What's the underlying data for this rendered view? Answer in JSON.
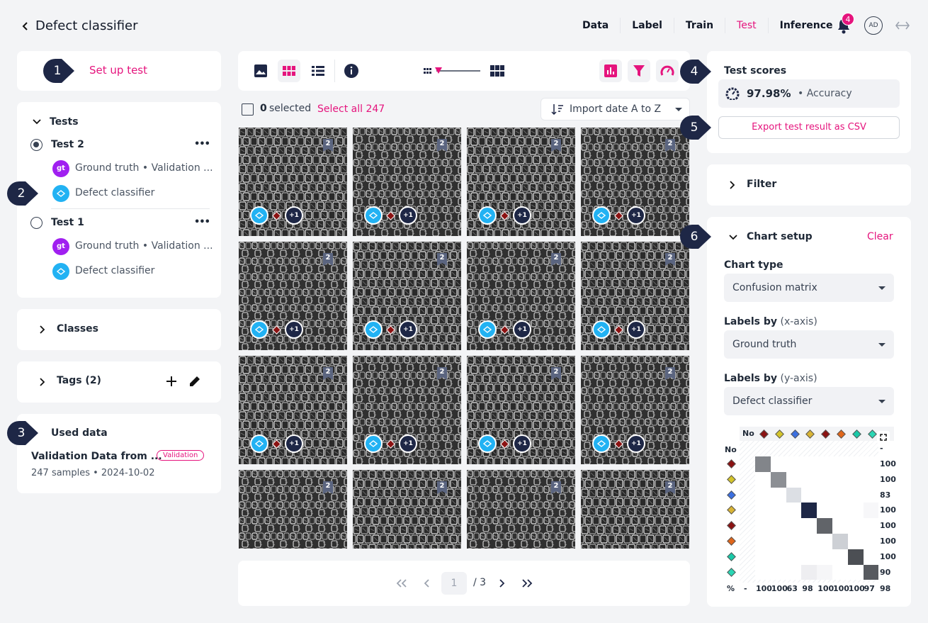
{
  "header": {
    "back_title": "Defect classifier",
    "nav": [
      "Data",
      "Label",
      "Train",
      "Test",
      "Inference"
    ],
    "active_nav": "Test",
    "notif_count": "4",
    "avatar": "AD"
  },
  "markers": [
    "1",
    "2",
    "3",
    "4",
    "5",
    "6"
  ],
  "left": {
    "setup_title": "Set up test",
    "tests_title": "Tests",
    "tests": [
      {
        "name": "Test 2",
        "gt_badge": "gt",
        "gt_label": "Ground truth • Validation ...",
        "model_label": "Defect classifier"
      },
      {
        "name": "Test 1",
        "gt_badge": "gt",
        "gt_label": "Ground truth • Validation ...",
        "model_label": "Defect classifier"
      }
    ],
    "more": "•••",
    "classes_title": "Classes",
    "tags_title": "Tags (2)",
    "used_title": "Used data",
    "used_name": "Validation Data from ...",
    "used_badge": "Validation",
    "used_meta": "247 samples • 2024-10-02"
  },
  "center": {
    "selected_count": "0",
    "selected_text": "selected",
    "select_all": "Select all 247",
    "sort": "Import date A to Z",
    "tile_badge": "2",
    "tile_more": "+1",
    "page_current": "1",
    "page_total": "/ 3"
  },
  "right": {
    "scores_title": "Test scores",
    "accuracy_value": "97.98%",
    "accuracy_label": "• Accuracy",
    "export_label": "Export test result as CSV",
    "filter_title": "Filter",
    "chart_setup_title": "Chart setup",
    "clear_label": "Clear",
    "chart_type_label": "Chart type",
    "chart_type_value": "Confusion matrix",
    "x_label_main": "Labels by",
    "x_label_sub": "(x-axis)",
    "x_value": "Ground truth",
    "y_label_main": "Labels by",
    "y_label_sub": "(y-axis)",
    "y_value": "Defect classifier"
  },
  "colors": {
    "accent": "#e5147d",
    "navy": "#1e2746",
    "model": "#22b2f3",
    "gt": "#a020f0"
  },
  "chart_data": {
    "type": "heatmap",
    "row_header": "No",
    "col_header": "No",
    "class_colors": [
      "#8b1212",
      "#d4c42a",
      "#3b6fe0",
      "#d9b435",
      "#8b1212",
      "#e0661a",
      "#19c9a8",
      "#2ad6b4"
    ],
    "row_percent": [
      "-",
      "100",
      "100",
      "83",
      "100",
      "100",
      "100",
      "100",
      "90"
    ],
    "col_percent": [
      "-",
      "100",
      "100",
      "63",
      "98",
      "100",
      "100",
      "100",
      "97"
    ],
    "total_label": "%",
    "total_value": "98",
    "diagonal_intensity": [
      0.5,
      0.45,
      0.08,
      0.95,
      0.65,
      0.15,
      0.75,
      0.7
    ]
  }
}
